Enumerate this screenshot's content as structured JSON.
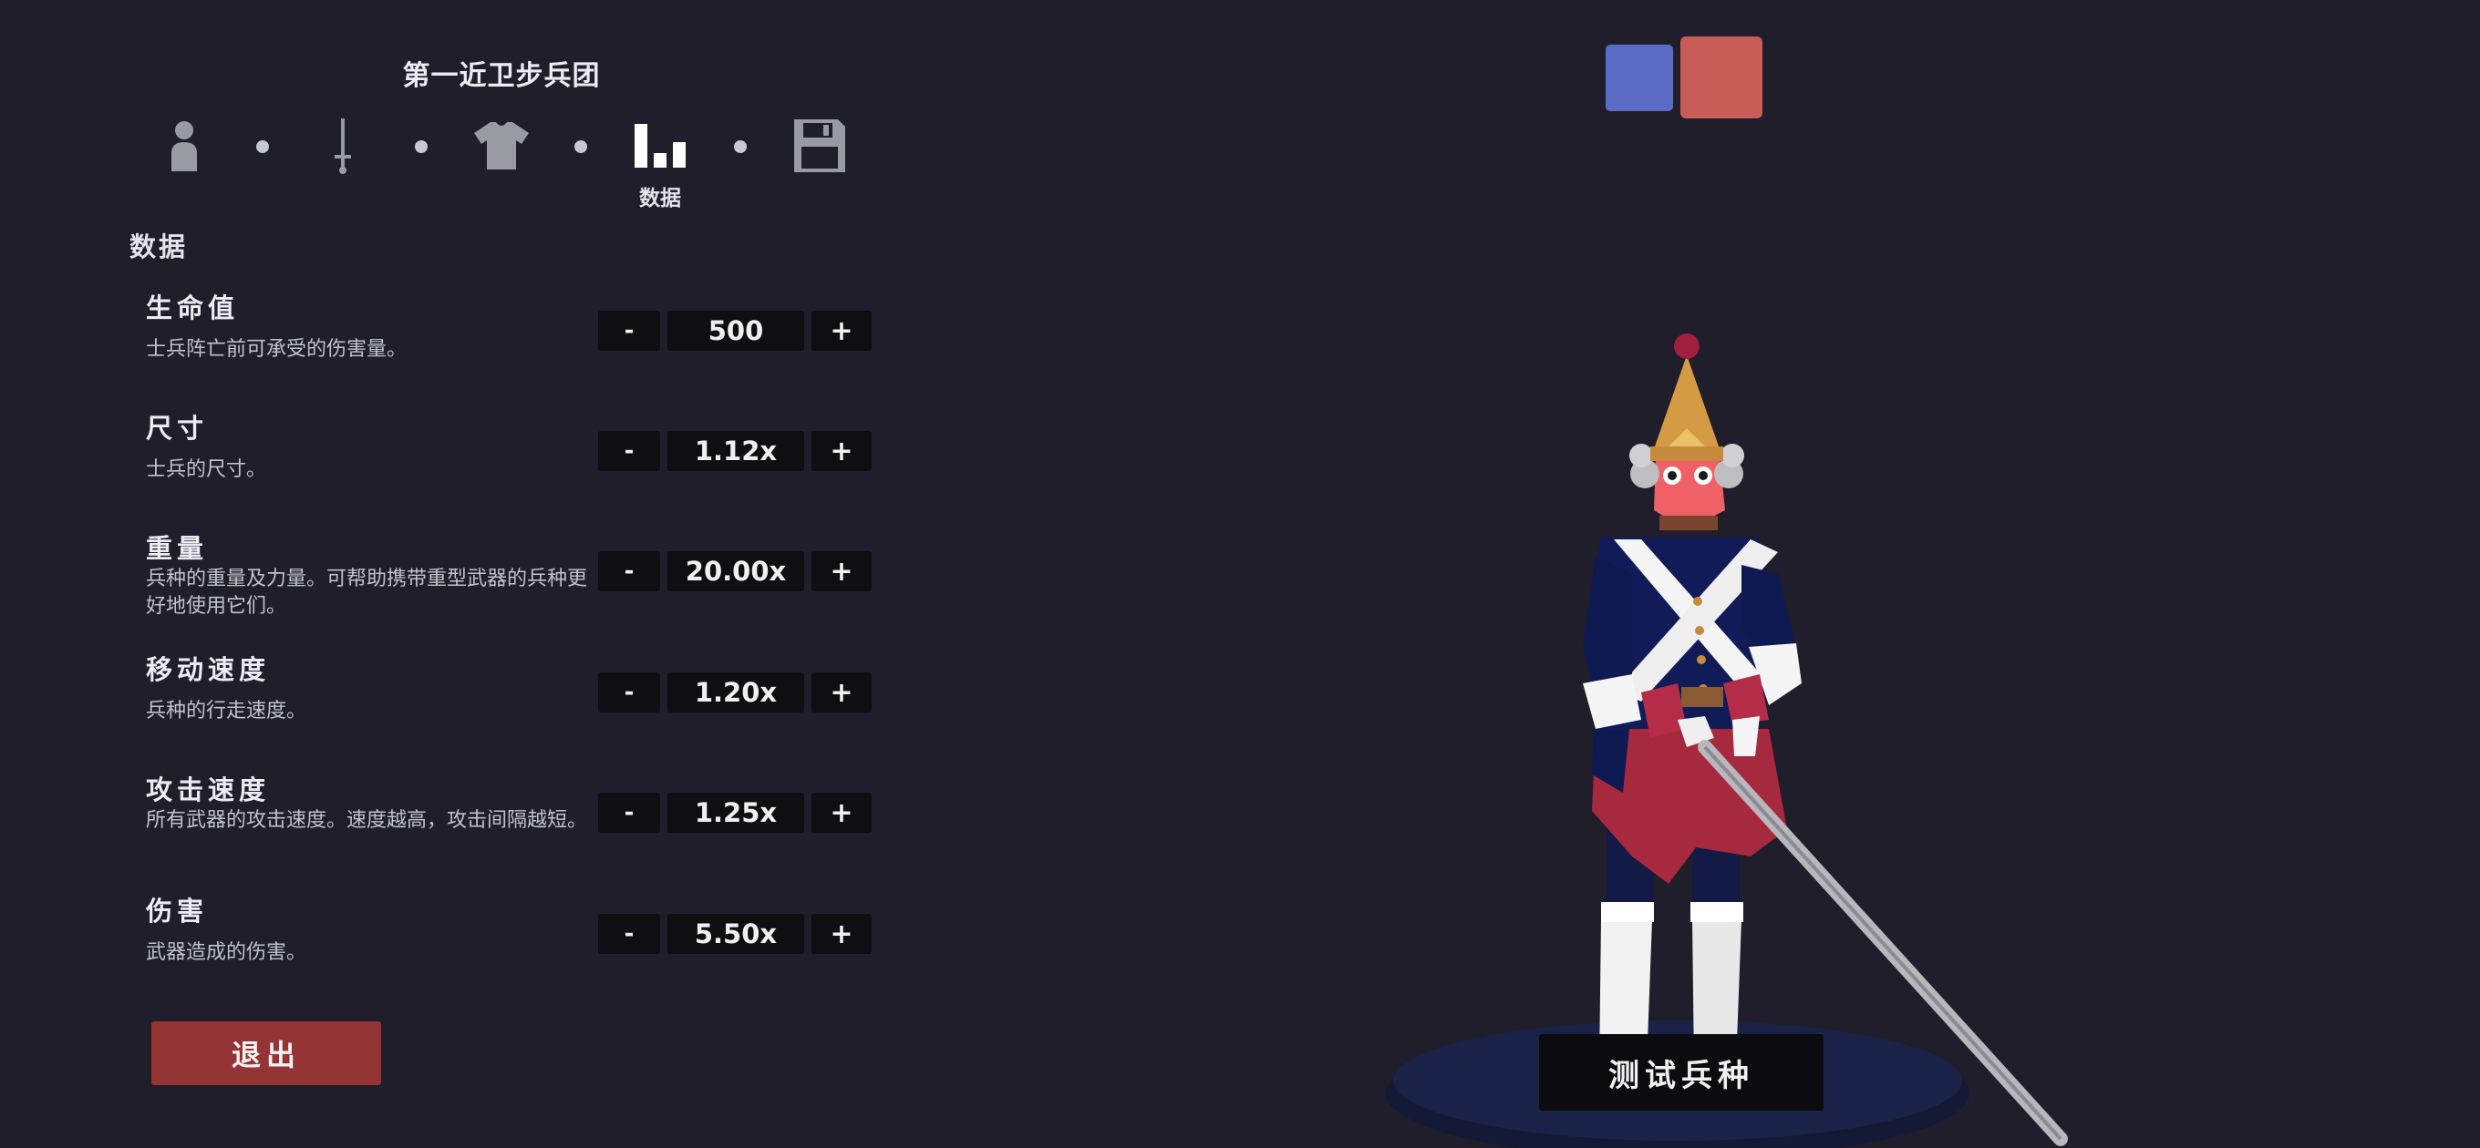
{
  "unit_name": "第一近卫步兵团",
  "steps": [
    {
      "icon": "person-icon",
      "label": ""
    },
    {
      "icon": "sword-icon",
      "label": ""
    },
    {
      "icon": "shirt-icon",
      "label": ""
    },
    {
      "icon": "bar-chart-icon",
      "label": "数据"
    },
    {
      "icon": "save-icon",
      "label": ""
    }
  ],
  "section_title": "数据",
  "stats": [
    {
      "name": "生命值",
      "description": "士兵阵亡前可承受的伤害量。",
      "value": "500",
      "minus": "-",
      "plus": "+"
    },
    {
      "name": "尺寸",
      "description": "士兵的尺寸。",
      "value": "1.12x",
      "minus": "-",
      "plus": "+"
    },
    {
      "name": "重量",
      "description": "兵种的重量及力量。可帮助携带重型武器的兵种更好地使用它们。",
      "value": "20.00x",
      "minus": "-",
      "plus": "+"
    },
    {
      "name": "移动速度",
      "description": "兵种的行走速度。",
      "value": "1.20x",
      "minus": "-",
      "plus": "+"
    },
    {
      "name": "攻击速度",
      "description": "所有武器的攻击速度。速度越高，攻击间隔越短。",
      "value": "1.25x",
      "minus": "-",
      "plus": "+"
    },
    {
      "name": "伤害",
      "description": "武器造成的伤害。",
      "value": "5.50x",
      "minus": "-",
      "plus": "+"
    }
  ],
  "exit_label": "退出",
  "test_label": "测试兵种",
  "colors": {
    "background": "#1f1e2a",
    "team_blue": "#5a6cc5",
    "team_red": "#c85c56",
    "exit_button": "#943434",
    "control_bg": "#0e0e13"
  }
}
